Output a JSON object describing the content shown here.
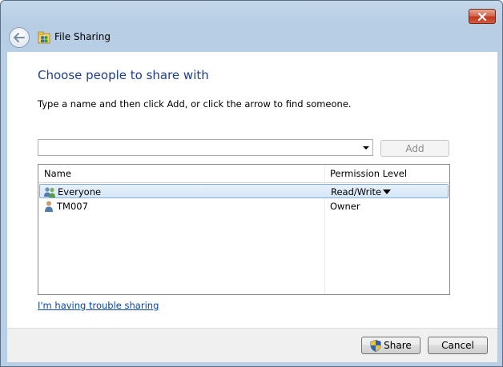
{
  "window": {
    "title": "File Sharing"
  },
  "main": {
    "heading": "Choose people to share with",
    "instruction": "Type a name and then click Add, or click the arrow to find someone.",
    "name_input": {
      "value": "",
      "placeholder": ""
    },
    "add_label": "Add"
  },
  "list": {
    "columns": [
      "Name",
      "Permission Level"
    ],
    "rows": [
      {
        "name": "Everyone",
        "permission": "Read/Write",
        "icon": "group-icon",
        "selected": true
      },
      {
        "name": "TM007",
        "permission": "Owner",
        "icon": "user-icon",
        "selected": false
      }
    ]
  },
  "trouble_link": "I'm having trouble sharing",
  "footer": {
    "share_label": "Share",
    "cancel_label": "Cancel"
  },
  "colors": {
    "heading": "#1e3e8a",
    "link": "#0645ad",
    "selection": "#d4e6f8",
    "close_button": "#c0391f"
  }
}
